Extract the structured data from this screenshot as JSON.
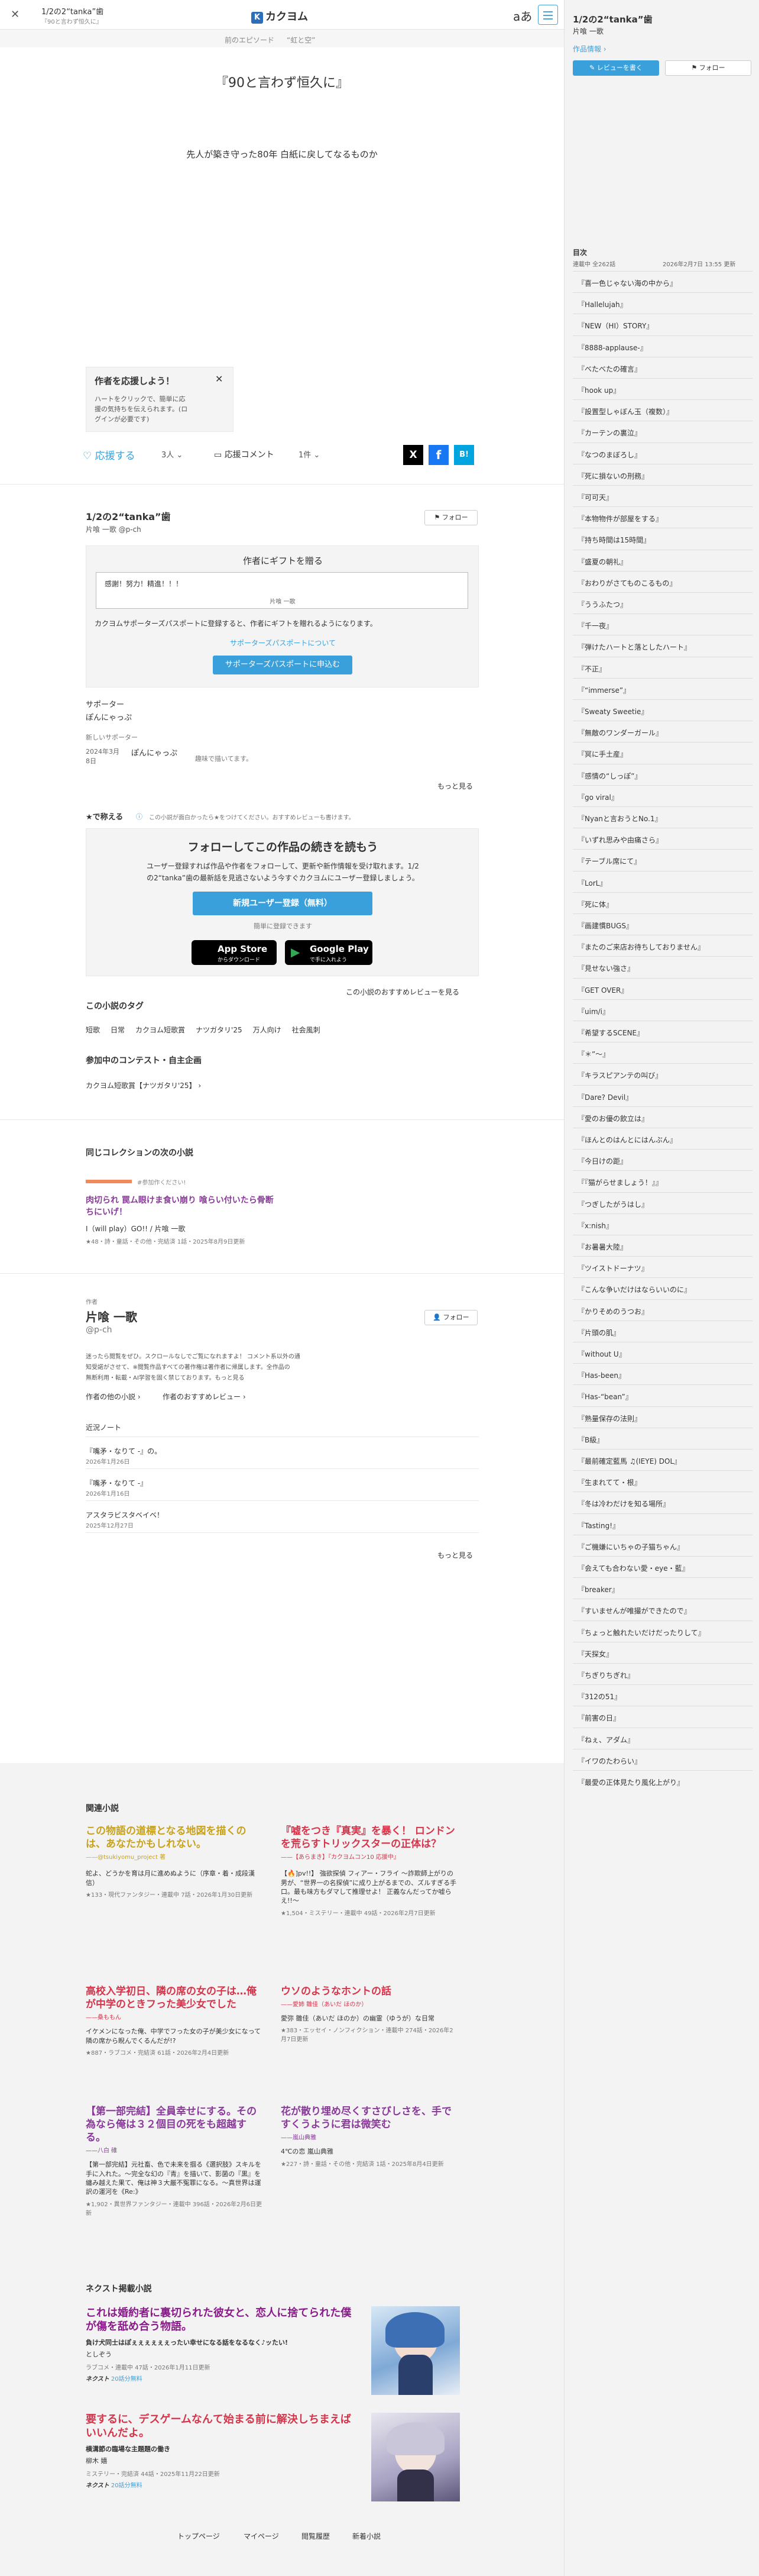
{
  "header": {
    "work_title": "1/2の2“tanka”歯",
    "work_subtitle": "『90と言わず恒久に』",
    "logo": "カクヨム",
    "font_icon": "aあ"
  },
  "episode_nav": {
    "prev": "前のエピソード",
    "next": "“虹と空”"
  },
  "episode": {
    "title": "『90と言わず恒久に』",
    "body": "先人が築き守った80年 白紙に戻してなるものか"
  },
  "support_popup": {
    "title": "作者を応援しよう！",
    "text": [
      "ハートをクリックで、簡単に応",
      "援の気持ちを伝えられます。(ロ",
      "グインが必要です)"
    ]
  },
  "reactions": {
    "support_label": "応援する",
    "support_count": "3人",
    "comment_label": "応援コメント",
    "comment_count": "1件",
    "share_x": "X",
    "share_fb": "f",
    "share_hb": "B!"
  },
  "work_info": {
    "title": "1/2の2“tanka”歯",
    "author": "片喰 一歌 @p-ch",
    "follow": "フォロー"
  },
  "gift": {
    "title": "作者にギフトを贈る",
    "message": "感謝！努力！精進！！！",
    "signature": "片喰 一歌",
    "desc": "カクヨムサポーターズパスポートに登録すると、作者にギフトを贈れるようになります。",
    "link": "サポーターズパスポートについて",
    "button": "サポーターズパスポートに申込む"
  },
  "supporters": {
    "label": "サポーター",
    "name": "ぽんにゃっぷ",
    "new_label": "新しいサポーター",
    "date1": "2024年3月",
    "date2": "8日",
    "new_name": "ぽんにゃっぷ",
    "new_text": "趣味で描いてます。",
    "more": "もっと見る"
  },
  "stars": {
    "heading": "★で称える",
    "note": "この小説が面白かったら★をつけてください。おすすめレビューも書けます。"
  },
  "follow_box": {
    "title": "フォローしてこの作品の続きを読もう",
    "text1": "ユーザー登録すれば作品や作者をフォローして、更新や新作情報を受け取れます。1/2",
    "text2": "の2“tanka”歯の最新話を見逃さないよう今すぐカクヨムにユーザー登録しましょう。",
    "signup": "新規ユーザー登録（無料）",
    "easy": "簡単に登録できます",
    "appstore": "App Store",
    "appstore_sub": "からダウンロード",
    "googleplay": "Google Play",
    "googleplay_sub": "で手に入れよう",
    "reviews_link": "この小説のおすすめレビューを見る"
  },
  "tags": {
    "heading": "この小説のタグ",
    "items": [
      "短歌",
      "日常",
      "カクヨム短歌賞",
      "ナツガタリ'25",
      "万人向け",
      "社会風刺"
    ]
  },
  "contest": {
    "heading": "参加中のコンテスト・自主企画",
    "item": "カクヨム短歌賞【ナツガタリ'25】"
  },
  "collection": {
    "heading": "同じコレクションの次の小説",
    "badge": "#参加作ください!",
    "title": "肉切られ 罠ム眼けま食い崩り 喰らい付いたら骨断ちにいげ！",
    "author": "I（will play）GO!! / 片喰 一歌",
    "meta": "★48・詩・童話・その他・完結済 1話・2025年8月9日更新"
  },
  "author_sec": {
    "label": "作者",
    "name": "片喰 一歌",
    "id": "@p-ch",
    "follow": "フォロー",
    "bio1": "迷ったら閲覧をぜひ。スクロールなしでご覧になれますよ！ コメント系以外の通",
    "bio2": "知受諾がさせて、※閲覧作品すべての著作権は著作者に帰属します。全作品の",
    "bio3": "無断利用・転載・AI学習を固く禁じております。もっと見る",
    "link1": "作者の他の小説",
    "link2": "作者のおすすめレビュー"
  },
  "notes": {
    "heading": "近況ノート",
    "items": [
      {
        "title": "『嘴矛・なりて -』の。",
        "date": "2026年1月26日"
      },
      {
        "title": "『嘴矛・なりて -』",
        "date": "2026年1月16日"
      },
      {
        "title": "アスタラビスタベイベ！",
        "date": "2025年12月27日"
      }
    ],
    "more": "もっと見る"
  },
  "related": {
    "heading": "関連小説",
    "items": [
      {
        "title": "この物語の道標となる地図を描くのは、あなたかもしれない。",
        "by": "——@tsukiyomu_project 著",
        "desc": "蛇よ、どうかを育は月に進めぬように（序章・着・成段漢信）",
        "meta": "★133・現代ファンタジー・連載中 7話・2026年1月30日更新",
        "color": "#c9a21b"
      },
      {
        "title": "『嘘をつき『真実』を暴く！ ロンドンを荒らすトリックスターの正体は？",
        "by": "——【あらまき】『カクヨムコン10 応援中』",
        "desc": "【🔥]pv!!】 強欲探偵 フィアー・フライ ～詐欺師上がりの男が、“世界一の名探偵”に成り上がるまでの、ズルすぎる手口。最も味方もダマして推理せよ！ 正義なんだってか嘘らえ!!～",
        "meta": "★1,504・ミステリー・連載中 49話・2026年2月7日更新",
        "color": "#d6344a"
      },
      {
        "title": "高校入学初日、隣の席の女の子は…俺が中学のときフった美少女でした",
        "by": "——桑ももん",
        "desc": "イケメンになった俺、中学でフった女の子が美少女になって隣の席から睨んでくるんだが!?",
        "meta": "★887・ラブコメ・完結済 61話・2026年2月4日更新",
        "color": "#d6344a"
      },
      {
        "title": "ウソのようなホントの話",
        "by": "——愛姉 雛佳（あいだ ほのか）",
        "desc": "愛弥 雛佳（あいだ ほのか）の幽霊（ゆうが）な日常",
        "meta": "★383・エッセイ・ノンフィクション・連載中 274話・2026年2月7日更新",
        "color": "#d6344a"
      },
      {
        "title": "【第一部完結】全員幸せにする。その為なら俺は３２個目の死をも超越する。",
        "by": "——八白 碓",
        "desc": "【第一部完結】元社畜、色で未来を掴る《選択肢》スキルを手に入れた。〜完全な幻の『青』を描いて、影菌の『黒』を纏み越えた果て、俺は神３大厳不冤罪になる。〜真世界は運訳の運河を《Re:》",
        "meta": "★1,902・異世界ファンタジー・連載中 396話・2026年2月6日更新",
        "color": "#8a3a9a"
      },
      {
        "title": "花が散り埋め尽くすさびしさを、手ですくうように君は微笑む",
        "by": "——嵐山典雅",
        "desc": "4℃の恋 嵐山典雅",
        "meta": "★227・詩・童話・その他・完結済 1話・2025年8月4日更新",
        "color": "#8a3a9a"
      }
    ]
  },
  "next_ads": {
    "heading": "ネクスト掲載小説",
    "items": [
      {
        "title": "これは婚約者に裏切られた彼女と、恋人に捨てられた僕が傷を舐め合う物語。",
        "sub": "負け犬同士はぽぇぇぇぇぇぇったい幸せになる話をなるなく♪ッたい!",
        "author": "としぞう",
        "meta": "ラブコメ・連載中 47話・2026年1月11日更新",
        "next": "ネクスト",
        "next_free": "20話分無料",
        "color": "#8a1a8a"
      },
      {
        "title": "要するに、デスゲームなんて始まる前に解決しちまえばいいんだよ。",
        "sub": "横溝節の臨場な主題題の働き",
        "author": "柳木 嬉",
        "meta": "ミステリー・完結済 44話・2025年11月22日更新",
        "next": "ネクスト",
        "next_free": "20話分無料",
        "color": "#d6344a"
      }
    ]
  },
  "footer_links": [
    "トップページ",
    "マイページ",
    "閲覧履歴",
    "新着小説"
  ],
  "sidebar": {
    "title": "1/2の2“tanka”歯",
    "author": "片喰 一歌",
    "info_link": "作品情報",
    "review_btn": "レビューを書く",
    "follow_btn": "フォロー",
    "toc_label": "目次",
    "toc_count": "連載中 全262話",
    "toc_updated": "2026年2月7日 13:55 更新",
    "toc": [
      "『喜一色じゃない海の中から』",
      "『Hallelujah』",
      "『NEW（HI）STORY』",
      "『8888-applause-』",
      "『べたべたの確言』",
      "『hook up』",
      "『設置型しゃぼん玉（複数）』",
      "『カーテンの裏泣』",
      "『なつのまぼろし』",
      "『死に損ないの刑務』",
      "『可可天』",
      "『本物物件が部屋をする』",
      "『持ち時間は15時間』",
      "『盛夏の朝礼』",
      "『おわりがさてものこるもの』",
      "『ううふたつ』",
      "『千一夜』",
      "『弾けたハートと落としたハート』",
      "『不正』",
      "『“immerse”』",
      "『Sweaty Sweetie』",
      "『無敵のワンダーガール』",
      "『冥に手土産』",
      "『感情の“しっぽ”』",
      "『go viral』",
      "『Nyanと言おうとNo.1』",
      "『いずれ思みや由痛さら』",
      "『テーブル席にて』",
      "『LorL』",
      "『死に体』",
      "『画建慣BUGS』",
      "『またのご来店お待ちしておりません』",
      "『見せない強さ』",
      "『GET OVER』",
      "『uim/i』",
      "『希望するSCENE』",
      "『＊”～』",
      "『キラスピアンテの叫び』",
      "『Dare? Devil』",
      "『愛のお優の飲立は』",
      "『ほんとのはんとにはんぶん』",
      "『今日けの距』",
      "『『猫がらせましょう！』』",
      "『つぎしたがうはし』",
      "『x:nish』",
      "『お暑暑大陸』",
      "『ツイストドーナツ』",
      "『こんな争いだけはならいいのに』",
      "『かりそめのうつお』",
      "『片頭の肌』",
      "『without U』",
      "『Has-been』",
      "『Has-“bean”』",
      "『熟量保存の法則』",
      "『B級』",
      "『最前確定藍馬 ♫(IEYE) DOL』",
      "『生まれてて・根』",
      "『冬は冷わだけを知る場所』",
      "『Tasting!』",
      "『ご機嫌にいちゃの子猫ちゃん』",
      "『会えても合わない愛・eye・藍』",
      "『breaker』",
      "『すいませんが唯撮ができたので』",
      "『ちょっと触れたいだけだったりして』",
      "『天探女』",
      "『ちぎりちぎれ』",
      "『312の51』",
      "『前害の日』",
      "『ねぇ、アダム』",
      "『イワのたわらい』",
      "『最愛の正体見たり風化上がり』"
    ]
  }
}
